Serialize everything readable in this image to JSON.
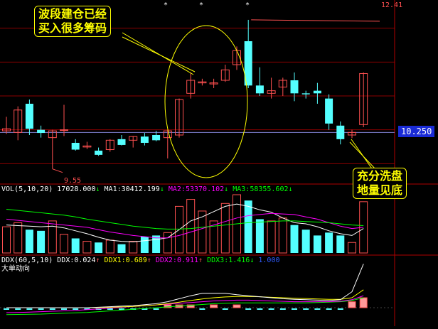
{
  "colors": {
    "background": "#000000",
    "up": "#ff5050",
    "down": "#54ffff",
    "grid": "#8b0000",
    "ma1": "#ffffff",
    "ma2": "#ff00ff",
    "ma3": "#00ff00",
    "ddx": "#ffffff",
    "ddx1": "#ffff00",
    "ddx2": "#ff00ff",
    "ddx3": "#00ff00",
    "price_box": "#1a2bd6"
  },
  "annotations": {
    "top_callout_line1": "波段建仓已经",
    "top_callout_line2": "买入很多筹码",
    "bottom_callout_line1": "充分洗盘",
    "bottom_callout_line2": "地量见底"
  },
  "price_panel": {
    "high_marker": "12.41",
    "low_marker": "9.55",
    "current_price": "10.250",
    "star_glyph": "*"
  },
  "volume_panel": {
    "name": "VOL(5,10,20)",
    "value": "17028.000",
    "value_arrow": "↓",
    "ma1_label": "MA1:",
    "ma1_value": "30412.199",
    "ma1_arrow": "↓",
    "ma2_label": "MA2:",
    "ma2_value": "53370.102",
    "ma2_arrow": "↓",
    "ma3_label": "MA3:",
    "ma3_value": "58355.602",
    "ma3_arrow": "↓"
  },
  "ddx_panel": {
    "name": "DDX(60,5,10)",
    "ddx_label": "DDX:",
    "ddx_value": "0.024",
    "ddx_arrow": "↑",
    "ddx1_label": "DDX1:",
    "ddx1_value": "0.689",
    "ddx1_arrow": "↑",
    "ddx2_label": "DDX2:",
    "ddx2_value": "0.911",
    "ddx2_arrow": "↑",
    "ddx3_label": "DDX3:",
    "ddx3_value": "1.416",
    "ddx3_arrow": "↓",
    "extra_value": "1.000",
    "subtitle": "大单动向"
  },
  "chart_data": {
    "type": "candlestick",
    "price_axis_range": [
      9.3,
      12.6
    ],
    "candles": [
      {
        "o": 10.28,
        "h": 10.55,
        "l": 10.22,
        "c": 10.32
      },
      {
        "o": 10.25,
        "h": 10.75,
        "l": 10.1,
        "c": 10.68
      },
      {
        "o": 10.8,
        "h": 10.88,
        "l": 10.2,
        "c": 10.32
      },
      {
        "o": 10.3,
        "h": 10.38,
        "l": 10.15,
        "c": 10.24
      },
      {
        "o": 10.15,
        "h": 10.3,
        "l": 9.55,
        "c": 10.28
      },
      {
        "o": 10.3,
        "h": 10.78,
        "l": 10.18,
        "c": 10.3
      },
      {
        "o": 10.05,
        "h": 10.12,
        "l": 9.9,
        "c": 9.92
      },
      {
        "o": 9.97,
        "h": 10.07,
        "l": 9.93,
        "c": 9.99
      },
      {
        "o": 9.9,
        "h": 9.96,
        "l": 9.8,
        "c": 9.82
      },
      {
        "o": 9.92,
        "h": 10.12,
        "l": 9.88,
        "c": 10.1
      },
      {
        "o": 10.12,
        "h": 10.2,
        "l": 10.0,
        "c": 10.01
      },
      {
        "o": 10.1,
        "h": 10.18,
        "l": 9.96,
        "c": 10.17
      },
      {
        "o": 10.17,
        "h": 10.24,
        "l": 10.0,
        "c": 10.05
      },
      {
        "o": 10.2,
        "h": 10.28,
        "l": 10.08,
        "c": 10.1
      },
      {
        "o": 10.15,
        "h": 10.3,
        "l": 9.75,
        "c": 10.28
      },
      {
        "o": 10.2,
        "h": 10.9,
        "l": 10.15,
        "c": 10.88
      },
      {
        "o": 11.0,
        "h": 11.4,
        "l": 10.9,
        "c": 11.25
      },
      {
        "o": 11.2,
        "h": 11.28,
        "l": 11.15,
        "c": 11.22
      },
      {
        "o": 11.18,
        "h": 11.28,
        "l": 11.1,
        "c": 11.2
      },
      {
        "o": 11.25,
        "h": 11.55,
        "l": 11.22,
        "c": 11.45
      },
      {
        "o": 11.55,
        "h": 11.9,
        "l": 11.45,
        "c": 11.82
      },
      {
        "o": 12.0,
        "h": 12.41,
        "l": 11.1,
        "c": 11.15
      },
      {
        "o": 11.15,
        "h": 11.5,
        "l": 10.95,
        "c": 11.0
      },
      {
        "o": 11.0,
        "h": 11.3,
        "l": 10.9,
        "c": 11.05
      },
      {
        "o": 11.12,
        "h": 11.3,
        "l": 10.95,
        "c": 11.25
      },
      {
        "o": 11.25,
        "h": 11.4,
        "l": 10.85,
        "c": 11.0
      },
      {
        "o": 11.0,
        "h": 11.05,
        "l": 10.9,
        "c": 10.98
      },
      {
        "o": 11.05,
        "h": 11.2,
        "l": 10.8,
        "c": 11.0
      },
      {
        "o": 10.9,
        "h": 10.98,
        "l": 10.3,
        "c": 10.42
      },
      {
        "o": 10.38,
        "h": 10.46,
        "l": 10.02,
        "c": 10.12
      },
      {
        "o": 10.2,
        "h": 10.3,
        "l": 10.14,
        "c": 10.25
      },
      {
        "o": 10.4,
        "h": 11.4,
        "l": 10.35,
        "c": 11.38
      }
    ],
    "volume": [
      0.45,
      0.52,
      0.4,
      0.38,
      0.55,
      0.32,
      0.25,
      0.2,
      0.18,
      0.22,
      0.15,
      0.2,
      0.28,
      0.3,
      0.35,
      0.8,
      0.92,
      0.72,
      0.55,
      0.85,
      1.0,
      0.9,
      0.58,
      0.55,
      0.6,
      0.48,
      0.4,
      0.3,
      0.35,
      0.3,
      0.18,
      0.88
    ],
    "vol_ma1": [
      0.48,
      0.47,
      0.46,
      0.45,
      0.46,
      0.43,
      0.38,
      0.33,
      0.27,
      0.22,
      0.2,
      0.19,
      0.21,
      0.23,
      0.26,
      0.4,
      0.55,
      0.62,
      0.71,
      0.8,
      0.84,
      0.8,
      0.74,
      0.7,
      0.6,
      0.52,
      0.5,
      0.45,
      0.38,
      0.33,
      0.3,
      0.42
    ],
    "vol_ma2": [
      0.58,
      0.56,
      0.54,
      0.52,
      0.5,
      0.48,
      0.46,
      0.44,
      0.4,
      0.36,
      0.33,
      0.3,
      0.28,
      0.26,
      0.26,
      0.3,
      0.36,
      0.42,
      0.48,
      0.54,
      0.6,
      0.64,
      0.66,
      0.68,
      0.67,
      0.66,
      0.62,
      0.58,
      0.52,
      0.46,
      0.42,
      0.44
    ],
    "vol_ma3": [
      0.75,
      0.73,
      0.71,
      0.69,
      0.67,
      0.65,
      0.62,
      0.58,
      0.55,
      0.52,
      0.49,
      0.46,
      0.44,
      0.42,
      0.41,
      0.41,
      0.42,
      0.44,
      0.46,
      0.48,
      0.5,
      0.52,
      0.53,
      0.54,
      0.55,
      0.55,
      0.54,
      0.53,
      0.52,
      0.5,
      0.48,
      0.47
    ],
    "ddx_bars": [
      -0.1,
      -0.1,
      -0.1,
      -0.1,
      -0.1,
      -0.1,
      -0.1,
      -0.1,
      -0.1,
      -0.1,
      -0.1,
      -0.1,
      -0.1,
      -0.1,
      0.15,
      0.1,
      0.1,
      -0.1,
      0.1,
      -0.1,
      0.1,
      -0.1,
      -0.1,
      -0.1,
      -0.1,
      -0.1,
      -0.1,
      -0.1,
      -0.1,
      -0.1,
      0.3,
      0.5
    ],
    "ddx_line": [
      0.0,
      0.0,
      0.0,
      0.0,
      0.0,
      0.0,
      0.0,
      0.0,
      0.02,
      0.05,
      0.08,
      0.1,
      0.15,
      0.2,
      0.3,
      0.45,
      0.6,
      0.72,
      0.72,
      0.72,
      0.65,
      0.6,
      0.55,
      0.5,
      0.45,
      0.42,
      0.4,
      0.38,
      0.36,
      0.4,
      0.8,
      2.2
    ],
    "ddx1_line": [
      0.0,
      0.0,
      0.0,
      0.0,
      0.0,
      0.0,
      0.0,
      0.0,
      0.0,
      0.02,
      0.04,
      0.06,
      0.1,
      0.14,
      0.2,
      0.28,
      0.36,
      0.44,
      0.5,
      0.54,
      0.56,
      0.56,
      0.55,
      0.52,
      0.5,
      0.48,
      0.46,
      0.44,
      0.42,
      0.42,
      0.5,
      0.9
    ],
    "ddx2_line": [
      -0.25,
      -0.24,
      -0.22,
      -0.2,
      -0.18,
      -0.16,
      -0.14,
      -0.1,
      -0.06,
      -0.02,
      0.02,
      0.06,
      0.1,
      0.14,
      0.18,
      0.22,
      0.26,
      0.3,
      0.34,
      0.36,
      0.38,
      0.38,
      0.36,
      0.34,
      0.32,
      0.3,
      0.3,
      0.3,
      0.3,
      0.32,
      0.4,
      0.6
    ],
    "ddx3_line": [
      -0.35,
      -0.34,
      -0.33,
      -0.32,
      -0.3,
      -0.28,
      -0.26,
      -0.24,
      -0.2,
      -0.16,
      -0.12,
      -0.08,
      -0.04,
      0.0,
      0.04,
      0.08,
      0.12,
      0.16,
      0.2,
      0.22,
      0.24,
      0.24,
      0.24,
      0.24,
      0.24,
      0.24,
      0.24,
      0.26,
      0.28,
      0.3,
      0.36,
      0.5
    ]
  }
}
